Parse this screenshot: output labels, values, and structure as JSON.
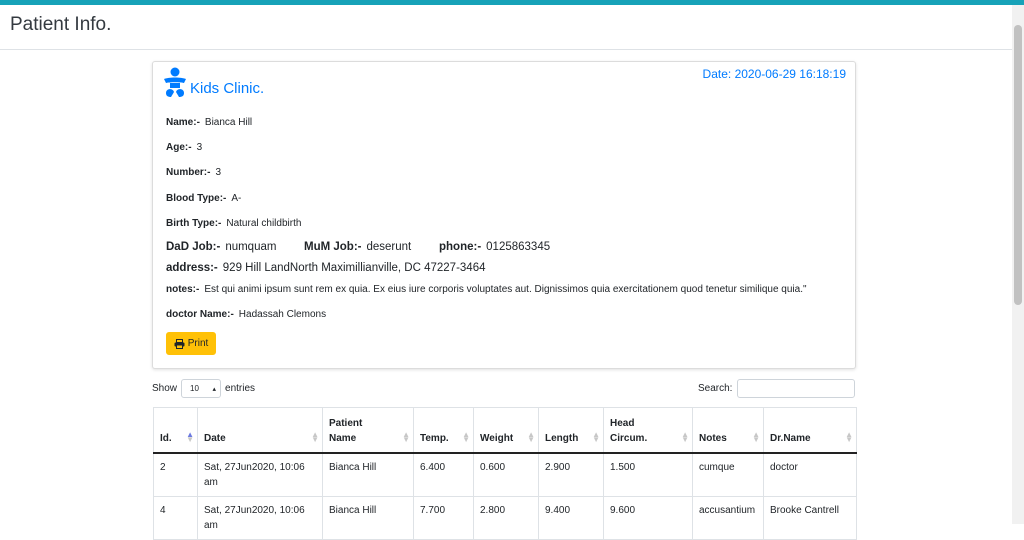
{
  "header": {
    "title": "Patient Info."
  },
  "card": {
    "clinic_name": "Kids Clinic.",
    "date": "Date: 2020-06-29 16:18:19",
    "fields": {
      "name": {
        "label": "Name:-",
        "value": "Bianca Hill"
      },
      "age": {
        "label": "Age:-",
        "value": "3"
      },
      "number": {
        "label": "Number:-",
        "value": "3"
      },
      "blood_type": {
        "label": "Blood Type:-",
        "value": "A-"
      },
      "birth_type": {
        "label": "Birth Type:-",
        "value": "Natural childbirth"
      },
      "dad_job": {
        "label": "DaD Job:-",
        "value": "numquam"
      },
      "mum_job": {
        "label": "MuM Job:-",
        "value": "deserunt"
      },
      "phone": {
        "label": "phone:-",
        "value": "0125863345"
      },
      "address": {
        "label": "address:-",
        "value": "929 Hill LandNorth Maximillianville, DC 47227-3464"
      },
      "notes": {
        "label": "notes:-",
        "value": "Est qui animi ipsum sunt rem ex quia. Ex eius iure corporis voluptates aut. Dignissimos quia exercitationem quod tenetur similique quia.\""
      },
      "doctor": {
        "label": "doctor Name:-",
        "value": "Hadassah Clemons"
      }
    },
    "print_label": "Print"
  },
  "table_controls": {
    "show_label": "Show",
    "entries_value": "10",
    "entries_label": "entries",
    "search_label": "Search:"
  },
  "table": {
    "columns": [
      {
        "line1": "Id.",
        "line2": ""
      },
      {
        "line1": "Date",
        "line2": ""
      },
      {
        "line1": "Patient",
        "line2": "Name"
      },
      {
        "line1": "Temp.",
        "line2": ""
      },
      {
        "line1": "Weight",
        "line2": ""
      },
      {
        "line1": "Length",
        "line2": ""
      },
      {
        "line1": "Head",
        "line2": "Circum."
      },
      {
        "line1": "Notes",
        "line2": ""
      },
      {
        "line1": "Dr.Name",
        "line2": ""
      }
    ],
    "rows": [
      [
        "2",
        "Sat, 27Jun2020, 10:06 am",
        "Bianca Hill",
        "6.400",
        "0.600",
        "2.900",
        "1.500",
        "cumque",
        "doctor"
      ],
      [
        "4",
        "Sat, 27Jun2020, 10:06 am",
        "Bianca Hill",
        "7.700",
        "2.800",
        "9.400",
        "9.600",
        "accusantium",
        "Brooke Cantrell"
      ]
    ]
  },
  "colors": {
    "accent": "#17a2b8",
    "brand": "#007bff",
    "print_button": "#ffc107"
  }
}
